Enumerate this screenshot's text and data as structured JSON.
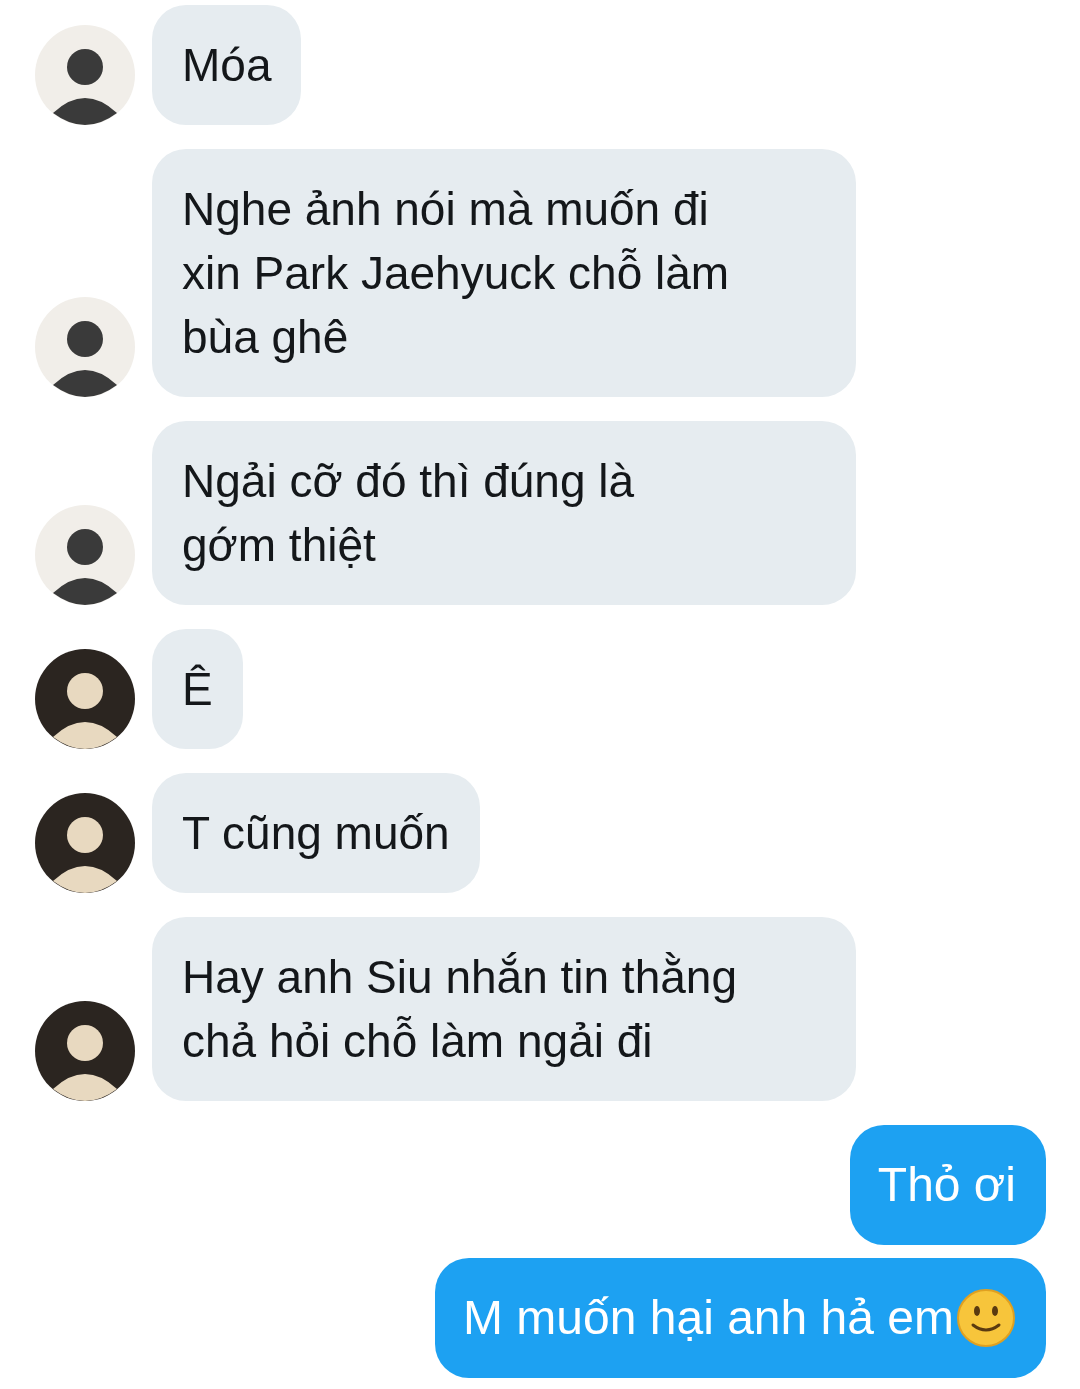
{
  "messages": [
    {
      "kind": "incoming",
      "color": "#f1eee9",
      "text": "Móa"
    },
    {
      "kind": "incoming",
      "color": "#f1eee9",
      "text": "Nghe ảnh nói mà muốn đi\nxin Park Jaehyuck chỗ làm\nbùa ghê"
    },
    {
      "kind": "incoming",
      "color": "#f1eee9",
      "text": "Ngải cỡ đó thì đúng là\ngớm thiệt"
    },
    {
      "kind": "incoming",
      "color": "#2b2520",
      "text": "Ê"
    },
    {
      "kind": "incoming",
      "color": "#2b2520",
      "text": "T cũng muốn"
    },
    {
      "kind": "incoming",
      "color": "#2b2520",
      "text": "Hay anh Siu nhắn tin thằng\nchả hỏi chỗ làm ngải đi"
    },
    {
      "kind": "outgoing",
      "text": "Thỏ ơi"
    },
    {
      "kind": "outgoing",
      "text": "M muốn hại anh hả em",
      "emoji": true
    }
  ]
}
